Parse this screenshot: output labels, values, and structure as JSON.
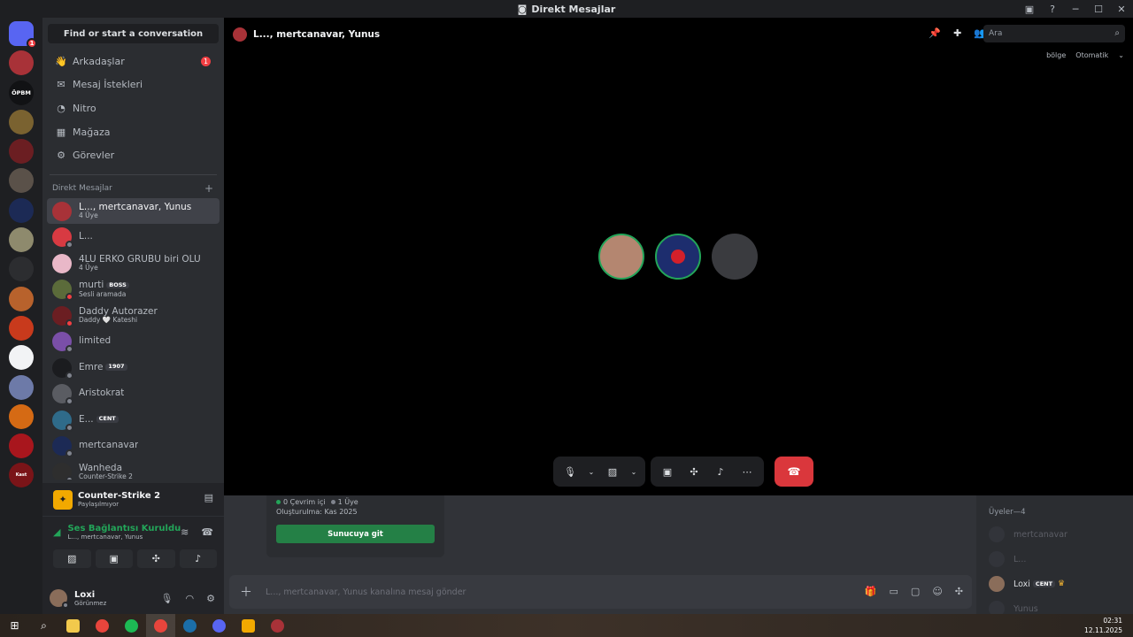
{
  "window": {
    "title": "Direkt Mesajlar"
  },
  "servers": [
    {
      "color": "#5865f2",
      "badge": "1",
      "label": ""
    },
    {
      "color": "#a83238",
      "badge": "",
      "label": ""
    },
    {
      "color": "#111214",
      "badge": "",
      "label": "ÖPBM"
    },
    {
      "color": "#7a6230",
      "badge": "",
      "label": ""
    },
    {
      "color": "#6b1e22",
      "badge": "",
      "label": ""
    },
    {
      "color": "#5a5149",
      "badge": "",
      "label": ""
    },
    {
      "color": "#1c2a55",
      "badge": "",
      "label": ""
    },
    {
      "color": "#8e8a6d",
      "badge": "",
      "label": ""
    },
    {
      "color": "#2c2d30",
      "badge": "",
      "label": ""
    },
    {
      "color": "#b8622c",
      "badge": "",
      "label": ""
    },
    {
      "color": "#c83a1c",
      "badge": "",
      "label": ""
    },
    {
      "color": "#f2f3f5",
      "badge": "",
      "label": ""
    },
    {
      "color": "#6d7aa8",
      "badge": "",
      "label": ""
    },
    {
      "color": "#d56a14",
      "badge": "",
      "label": ""
    },
    {
      "color": "#a8161d",
      "badge": "",
      "label": ""
    },
    {
      "color": "#7a1418",
      "badge": "",
      "label": "Kast"
    }
  ],
  "sidebar": {
    "search": "Find or start a conversation",
    "nav": [
      {
        "label": "Arkadaşlar",
        "icon": "friends-icon",
        "glyph": "👋",
        "badge": "1"
      },
      {
        "label": "Mesaj İstekleri",
        "icon": "mail-icon",
        "glyph": "✉",
        "badge": ""
      },
      {
        "label": "Nitro",
        "icon": "nitro-icon",
        "glyph": "◔",
        "badge": ""
      },
      {
        "label": "Mağaza",
        "icon": "shop-icon",
        "glyph": "▦",
        "badge": ""
      },
      {
        "label": "Görevler",
        "icon": "quests-icon",
        "glyph": "⚙",
        "badge": ""
      }
    ],
    "dm_header": "Direkt Mesajlar",
    "dms": [
      {
        "name": "L..., mertcanavar, Yunus",
        "sub": "4 Üye",
        "tag": "",
        "color": "#a83238",
        "status": "",
        "active": true
      },
      {
        "name": "L...",
        "sub": "",
        "tag": "",
        "color": "#d83a42",
        "status": "#80848e",
        "active": false
      },
      {
        "name": "4LÜ ERKO GRUBU biri ÖLÜ",
        "sub": "4 Üye",
        "tag": "",
        "color": "#e9b8c8",
        "status": "",
        "active": false
      },
      {
        "name": "murti",
        "sub": "Sesli aramada",
        "tag": "BOSS",
        "color": "#5b6b3a",
        "status": "#f23f43",
        "active": false
      },
      {
        "name": "Daddy Autorazer",
        "sub": "Daddy 🤍 Kateshi",
        "tag": "",
        "color": "#6b1e22",
        "status": "#f23f43",
        "active": false
      },
      {
        "name": "limited",
        "sub": "",
        "tag": "",
        "color": "#7a4fa8",
        "status": "#80848e",
        "active": false
      },
      {
        "name": "Emre",
        "sub": "",
        "tag": "1907",
        "color": "#1b1c1f",
        "status": "#80848e",
        "active": false
      },
      {
        "name": "Aristokrat",
        "sub": "",
        "tag": "",
        "color": "#5a5c62",
        "status": "#80848e",
        "active": false
      },
      {
        "name": "E...",
        "sub": "",
        "tag": "CENT",
        "color": "#2f6b8a",
        "status": "#80848e",
        "active": false
      },
      {
        "name": "mertcanavar",
        "sub": "",
        "tag": "",
        "color": "#1c2a55",
        "status": "#80848e",
        "active": false
      },
      {
        "name": "Wanheda",
        "sub": "Counter-Strike 2",
        "tag": "",
        "color": "#2e2e2e",
        "status": "#80848e",
        "active": false
      }
    ]
  },
  "panel": {
    "game": {
      "name": "Counter-Strike 2",
      "sub": "Paylaşılmıyor"
    },
    "voice": {
      "title": "Ses Bağlantısı Kuruldu",
      "sub": "L..., mertcanavar, Yunus"
    },
    "user": {
      "name": "Loxi",
      "status": "Görünmez"
    }
  },
  "call": {
    "title": "L..., mertcanavar, Yunus",
    "search_placeholder": "Ara",
    "region_label": "bölge",
    "region_value": "Otomatik"
  },
  "card": {
    "online": "0 Çevrim içi",
    "members": "1 Üye",
    "created": "Oluşturulma: Kas 2025",
    "button": "Sunucuya git"
  },
  "message": {
    "placeholder": "L..., mertcanavar, Yunus kanalına mesaj gönder"
  },
  "members": {
    "header": "Üyeler—4",
    "list": [
      {
        "name": "mertcanavar",
        "tag": "",
        "online": false
      },
      {
        "name": "L...",
        "tag": "",
        "online": false
      },
      {
        "name": "Loxi",
        "tag": "CENT",
        "online": true
      },
      {
        "name": "Yunus",
        "tag": "",
        "online": false
      }
    ]
  },
  "taskbar": {
    "time": "02:31",
    "date": "12.11.2025"
  },
  "colors": {
    "accent": "#5865f2",
    "green": "#23a559",
    "red": "#da373c"
  }
}
